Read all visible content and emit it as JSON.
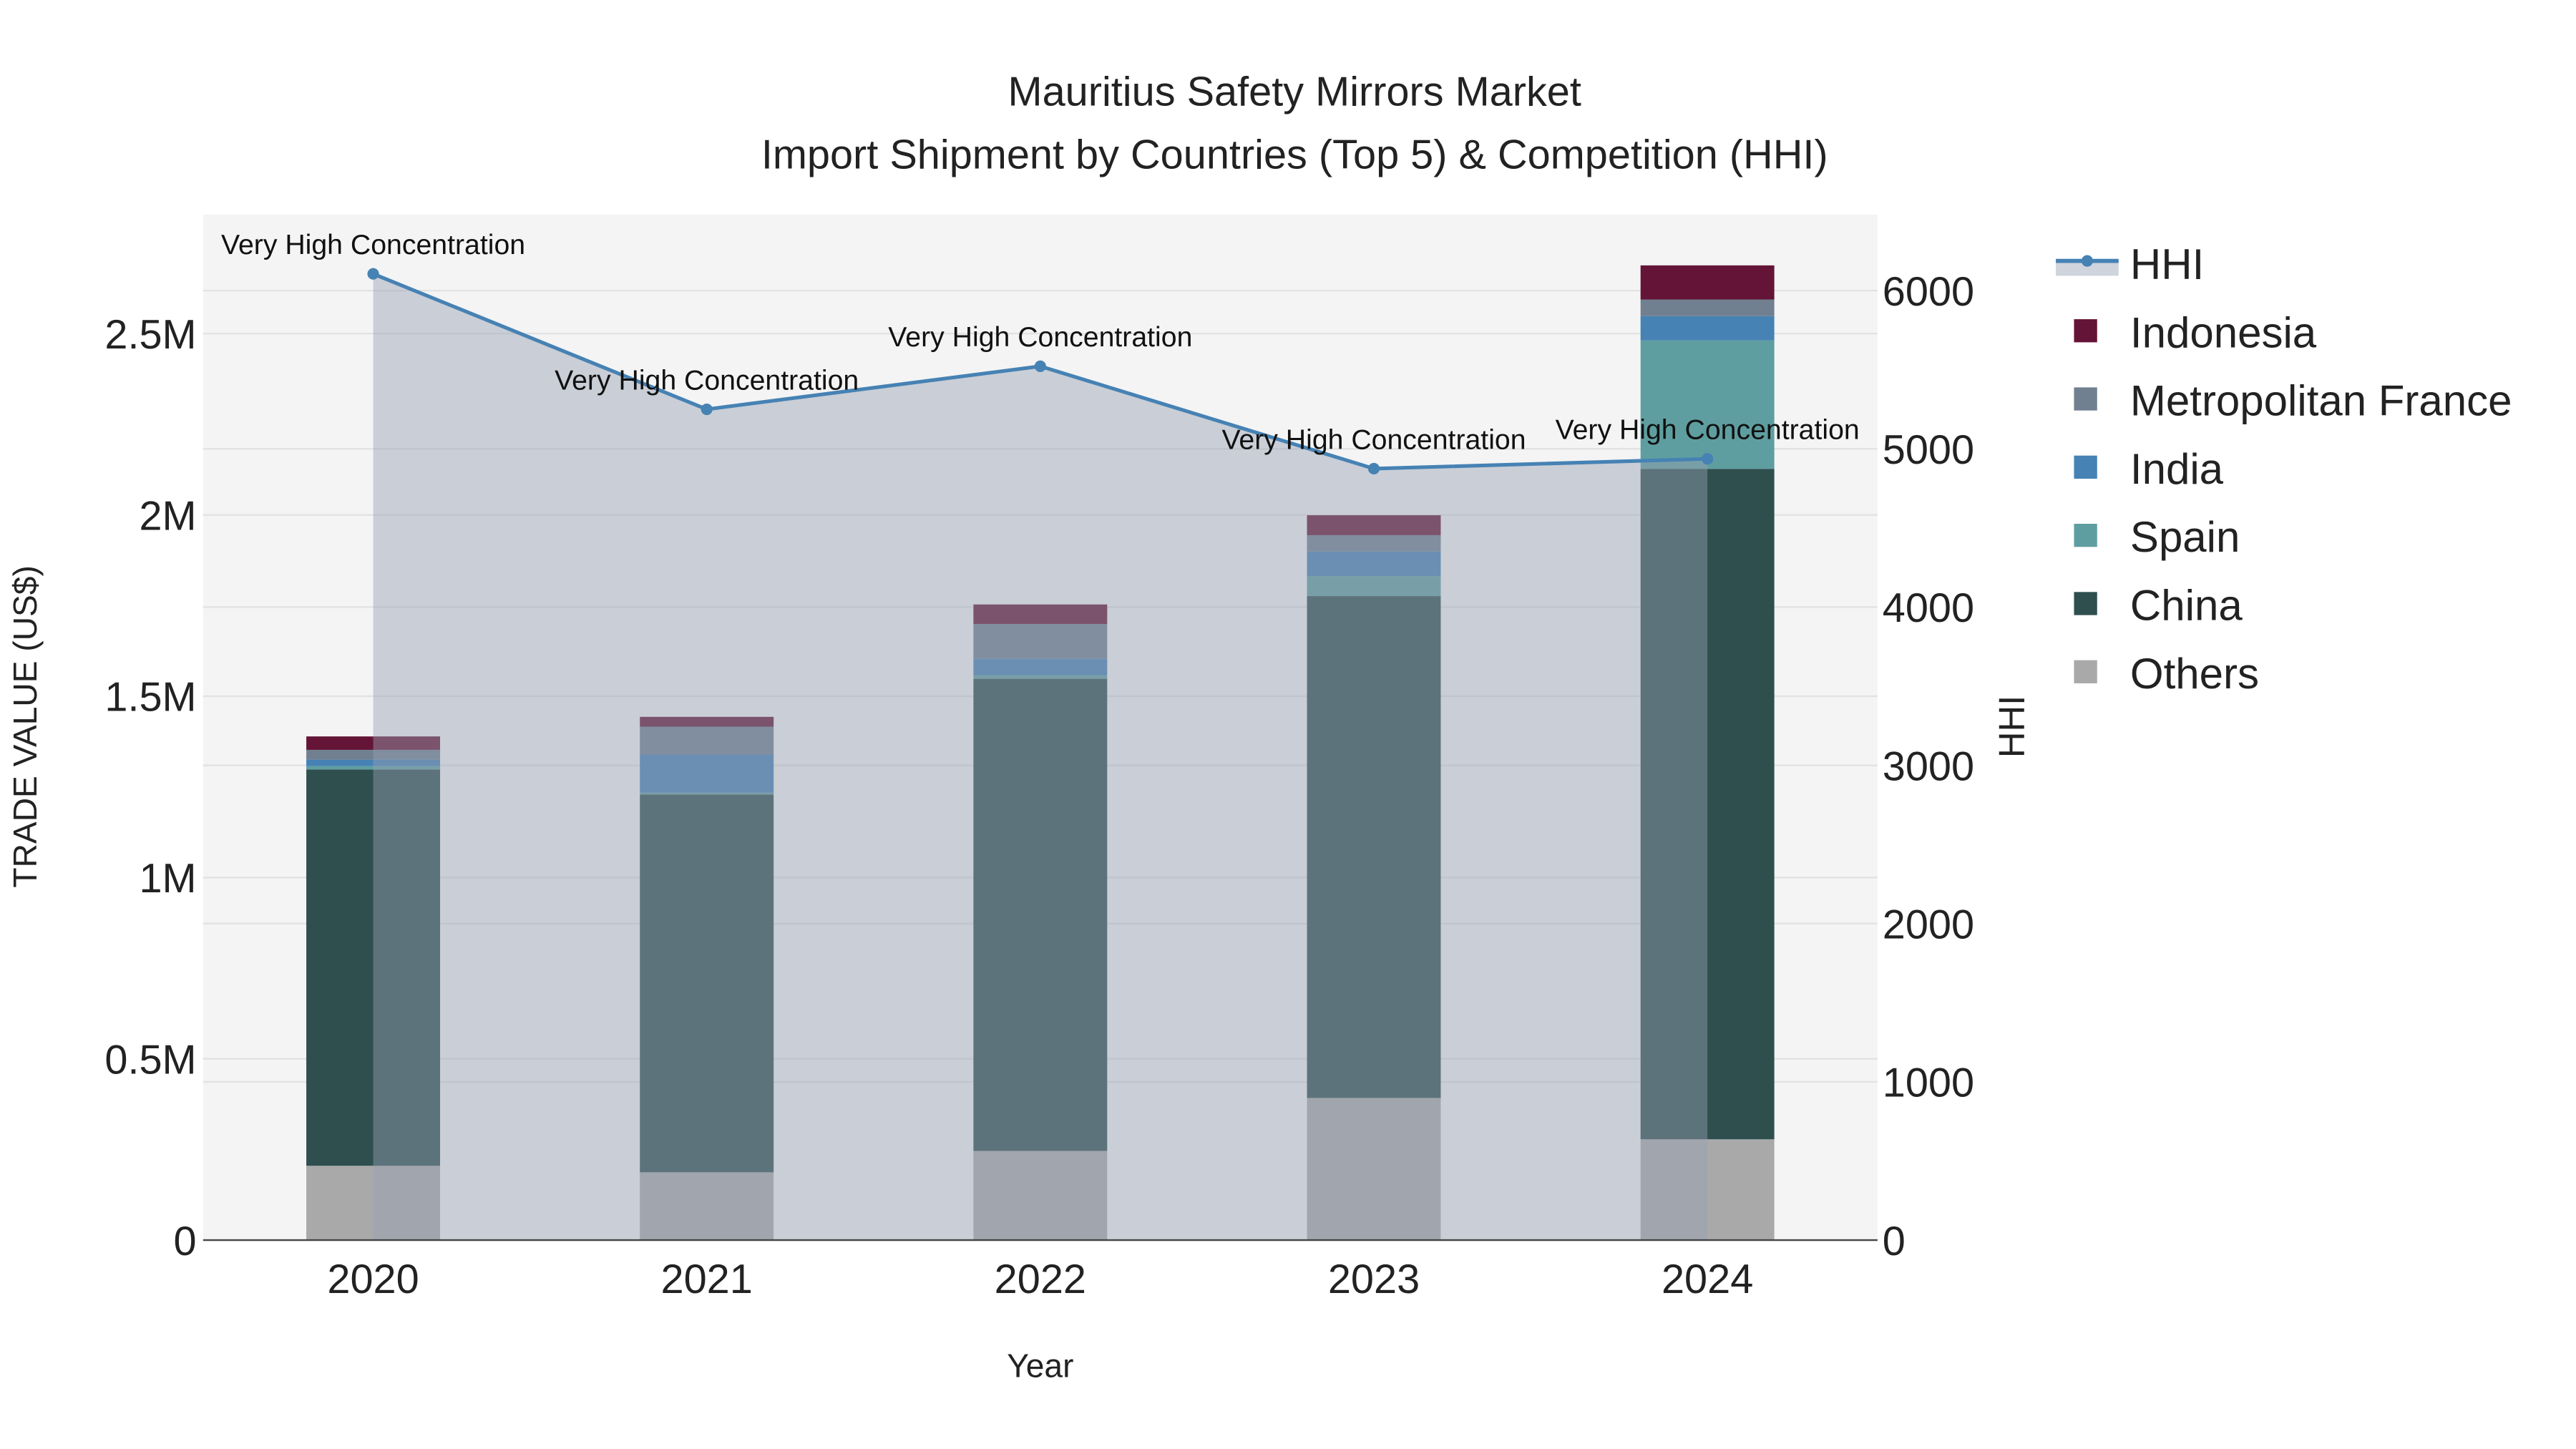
{
  "chart_data": {
    "type": "bar",
    "title_line1": "Mauritius Safety Mirrors Market",
    "title_line2": "Import Shipment by Countries (Top 5) & Competition (HHI)",
    "xlabel": "Year",
    "ylabel": "TRADE VALUE (US$)",
    "y2label": "HHI",
    "categories": [
      "2020",
      "2021",
      "2022",
      "2023",
      "2024"
    ],
    "ylim": [
      0,
      2830000
    ],
    "y2lim": [
      0,
      6500
    ],
    "yticks": [
      {
        "v": 0,
        "label": "0"
      },
      {
        "v": 500000,
        "label": "0.5M"
      },
      {
        "v": 1000000,
        "label": "1M"
      },
      {
        "v": 1500000,
        "label": "1.5M"
      },
      {
        "v": 2000000,
        "label": "2M"
      },
      {
        "v": 2500000,
        "label": "2.5M"
      }
    ],
    "y2ticks": [
      {
        "v": 0,
        "label": "0"
      },
      {
        "v": 1000,
        "label": "1000"
      },
      {
        "v": 2000,
        "label": "2000"
      },
      {
        "v": 3000,
        "label": "3000"
      },
      {
        "v": 4000,
        "label": "4000"
      },
      {
        "v": 5000,
        "label": "5000"
      },
      {
        "v": 6000,
        "label": "6000"
      }
    ],
    "series": [
      {
        "name": "Others",
        "color": "#a9a9a9",
        "values": [
          205000,
          187000,
          246000,
          392000,
          278000
        ]
      },
      {
        "name": "China",
        "color": "#2f4f4f",
        "values": [
          1093000,
          1042000,
          1302000,
          1384000,
          1849000
        ]
      },
      {
        "name": "Spain",
        "color": "#5f9ea0",
        "values": [
          9000,
          5000,
          10000,
          55000,
          354000
        ]
      },
      {
        "name": "India",
        "color": "#4682b4",
        "values": [
          18000,
          105000,
          45000,
          68000,
          67000
        ]
      },
      {
        "name": "Metropolitan France",
        "color": "#708090",
        "values": [
          27000,
          77000,
          96000,
          45000,
          46000
        ]
      },
      {
        "name": "Indonesia",
        "color": "#641436",
        "values": [
          37000,
          27000,
          54000,
          55000,
          94000
        ]
      }
    ],
    "hhi": {
      "name": "HHI",
      "color": "#4682b4",
      "values": [
        6106,
        5250,
        5522,
        4875,
        4937
      ],
      "annotations": [
        "Very High Concentration",
        "Very High Concentration",
        "Very High Concentration",
        "Very High Concentration",
        "Very High Concentration"
      ]
    },
    "legend_order": [
      "HHI",
      "Indonesia",
      "Metropolitan France",
      "India",
      "Spain",
      "China",
      "Others"
    ],
    "legend_placement": "right",
    "grid": true
  }
}
